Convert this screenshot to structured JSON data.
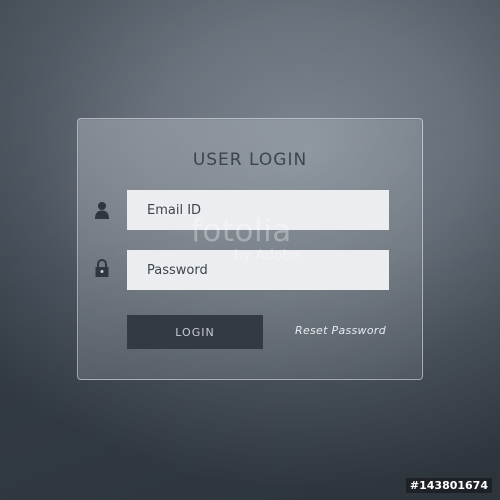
{
  "panel": {
    "title": "USER LOGIN",
    "email_placeholder": "Email ID",
    "password_placeholder": "Password",
    "login_label": "LOGIN",
    "reset_label": "Reset Password"
  },
  "icons": {
    "email": "user-icon",
    "password": "lock-icon"
  },
  "watermark": {
    "brand": "fotolia",
    "sub": "by Adobe"
  },
  "stock_id": "#143801674",
  "colors": {
    "button_bg": "#343a43",
    "field_bg": "#ecedf0",
    "title_text": "#3c4450"
  }
}
